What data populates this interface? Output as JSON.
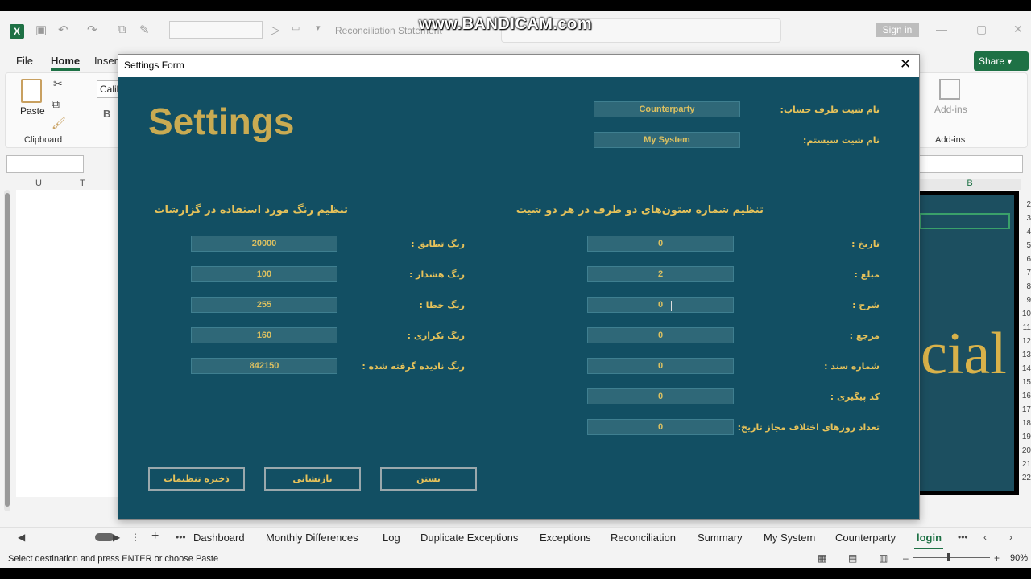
{
  "excel": {
    "doc_title": "Reconciliation Statement",
    "watermark": "www.BANDICAM.com",
    "signin": "Sign in",
    "menu": [
      "File",
      "Home",
      "Insert"
    ],
    "share": "Share",
    "ribbon": {
      "paste": "Paste",
      "clipboard": "Clipboard",
      "font_name": "Calib",
      "bold": "B",
      "addins_button": "Add-ins",
      "addins_group": "Add-ins"
    },
    "col_headers": [
      "U",
      "T"
    ],
    "right_col_header": "B",
    "cell_text": "cial",
    "row_numbers": [
      "2",
      "3",
      "4",
      "5",
      "6",
      "7",
      "8",
      "9",
      "10",
      "11",
      "12",
      "13",
      "14",
      "15",
      "16",
      "17",
      "18",
      "19",
      "20",
      "21",
      "22"
    ],
    "sheet_tabs": [
      "Dashboard",
      "Monthly Differences",
      "Log",
      "Duplicate Exceptions",
      "Exceptions",
      "Reconciliation",
      "Summary",
      "My System",
      "Counterparty",
      "login"
    ],
    "active_tab": "login",
    "status_text": "Select destination and press ENTER or choose Paste",
    "zoom": "90%"
  },
  "dialog": {
    "title": "Settings Form",
    "heading": "Settings",
    "sheet_names": {
      "counterparty_label": "نام شیت طرف حساب:",
      "counterparty_value": "Counterparty",
      "system_label": "نام شیت سیستم:",
      "system_value": "My System"
    },
    "colors_section": {
      "title": "تنظیم رنگ  مورد استفاده در گزارشات",
      "fields": [
        {
          "label": "رنگ تطابق :",
          "value": "20000"
        },
        {
          "label": "رنگ هشدار :",
          "value": "100"
        },
        {
          "label": "رنگ خطا :",
          "value": "255"
        },
        {
          "label": "رنگ تکراری :",
          "value": "160"
        },
        {
          "label": "رنگ نادیده گرفته شده :",
          "value": "842150"
        }
      ]
    },
    "columns_section": {
      "title": "تنظیم شماره ستون‌های دو طرف در هر دو شیت",
      "fields": [
        {
          "label": "تاریخ :",
          "value": "0"
        },
        {
          "label": "مبلغ :",
          "value": "2"
        },
        {
          "label": "شرح :",
          "value": "0"
        },
        {
          "label": "مرجع :",
          "value": "0"
        },
        {
          "label": "شماره سند :",
          "value": "0"
        },
        {
          "label": "کد پیگیری :",
          "value": "0"
        },
        {
          "label": "تعداد روزهای اختلاف مجاز تاریخ:",
          "value": "0"
        }
      ]
    },
    "buttons": {
      "save": "ذخیره تنظیمات",
      "reset": "بازنشانی",
      "close": "بستن"
    }
  },
  "colors": {
    "dialog_bg": "#124f63",
    "gold": "#e6c25a",
    "excel_green": "#1e7145"
  }
}
